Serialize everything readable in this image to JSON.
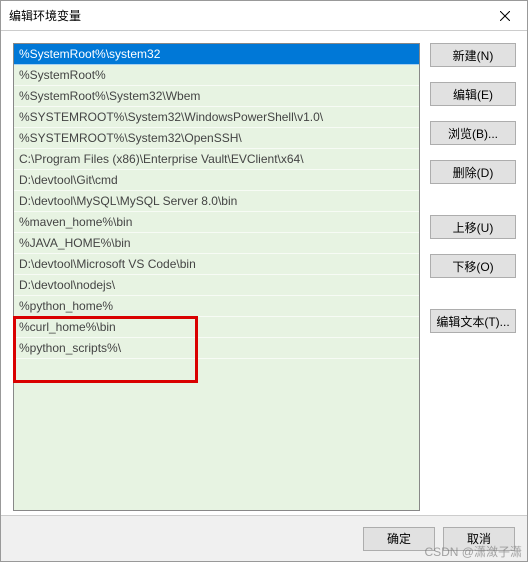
{
  "title": "编辑环境变量",
  "list_items": [
    {
      "value": "%SystemRoot%\\system32",
      "selected": true
    },
    {
      "value": "%SystemRoot%",
      "selected": false
    },
    {
      "value": "%SystemRoot%\\System32\\Wbem",
      "selected": false
    },
    {
      "value": "%SYSTEMROOT%\\System32\\WindowsPowerShell\\v1.0\\",
      "selected": false
    },
    {
      "value": "%SYSTEMROOT%\\System32\\OpenSSH\\",
      "selected": false
    },
    {
      "value": "C:\\Program Files (x86)\\Enterprise Vault\\EVClient\\x64\\",
      "selected": false
    },
    {
      "value": "D:\\devtool\\Git\\cmd",
      "selected": false
    },
    {
      "value": "D:\\devtool\\MySQL\\MySQL Server 8.0\\bin",
      "selected": false
    },
    {
      "value": "%maven_home%\\bin",
      "selected": false
    },
    {
      "value": "%JAVA_HOME%\\bin",
      "selected": false
    },
    {
      "value": "D:\\devtool\\Microsoft VS Code\\bin",
      "selected": false
    },
    {
      "value": "D:\\devtool\\nodejs\\",
      "selected": false
    },
    {
      "value": "%python_home%",
      "selected": false
    },
    {
      "value": "%curl_home%\\bin",
      "selected": false
    },
    {
      "value": "%python_scripts%\\",
      "selected": false
    }
  ],
  "buttons": {
    "new": "新建(N)",
    "edit": "编辑(E)",
    "browse": "浏览(B)...",
    "delete": "删除(D)",
    "move_up": "上移(U)",
    "move_down": "下移(O)",
    "edit_text": "编辑文本(T)..."
  },
  "footer": {
    "ok": "确定",
    "cancel": "取消"
  },
  "watermark": "CSDN @潇潋子潇"
}
